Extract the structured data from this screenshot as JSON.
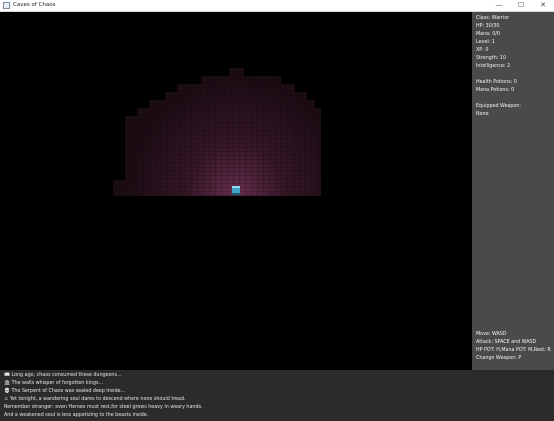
{
  "window": {
    "title": "Caves of Chaos",
    "minimize": "—",
    "maximize": "☐",
    "close": "✕"
  },
  "stats": {
    "class": "Class: Warrior",
    "hp": "HP: 30/30",
    "mana": "Mana: 0/0",
    "level": "Level: 1",
    "xp": "XP: 0",
    "strength": "Strength: 10",
    "intelligence": "Intelligence: 2",
    "health_potions": "Health Potions: 0",
    "mana_potions": "Mana Potions: 0",
    "equipped_label": "Equipped Weapon:",
    "equipped_value": "None",
    "controls": {
      "move": "Move: WASD",
      "attack": "Attack: SPACE and WASD",
      "potions": "HP POT: H,Mana POT: M,Rest: R",
      "weapon": "Change Weapon: P"
    }
  },
  "log": [
    "📖 Long ago, chaos consumed these dungeons...",
    "🏛 The walls whisper of forgotten kings...",
    "💀 The Serpent of Chaos was sealed deep inside...",
    "⚔ Yet tonight, a wandering soul dares to descend where none should tread.",
    "Remember stranger: even Heroes must rest,for steel grows heavy in weary hands.",
    "And a weakened soul is less appetizing to the beasts inside."
  ],
  "colors": {
    "stats_bg": "#4a4a4a",
    "log_bg": "#2b2b2b",
    "player": "#3fa2c9",
    "floor_glow": "#5a2a44"
  }
}
